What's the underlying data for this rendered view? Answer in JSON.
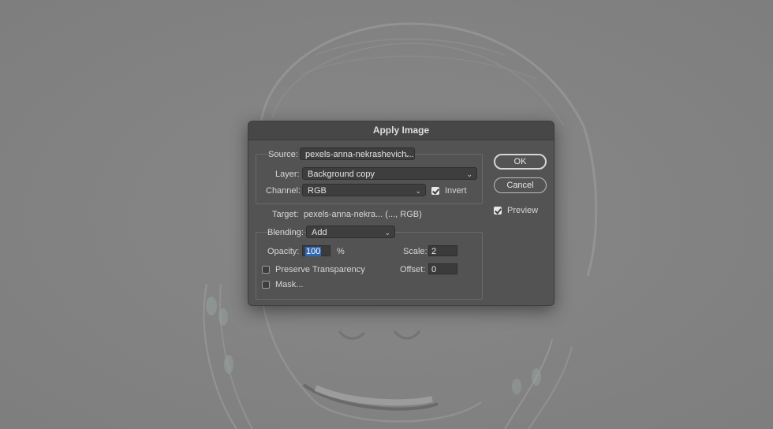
{
  "dialog": {
    "title": "Apply Image",
    "source": {
      "label": "Source:",
      "value": "pexels-anna-nekrashevich..."
    },
    "layer": {
      "label": "Layer:",
      "value": "Background copy"
    },
    "channel": {
      "label": "Channel:",
      "value": "RGB"
    },
    "invert": {
      "label": "Invert",
      "checked": true
    },
    "target": {
      "label": "Target:",
      "value": "pexels-anna-nekra... (..., RGB)"
    },
    "blending": {
      "label": "Blending:",
      "value": "Add"
    },
    "opacity": {
      "label": "Opacity:",
      "value": "100",
      "unit": "%"
    },
    "scale": {
      "label": "Scale:",
      "value": "2"
    },
    "offset": {
      "label": "Offset:",
      "value": "0"
    },
    "preserve_transparency": {
      "label": "Preserve Transparency",
      "checked": false
    },
    "mask": {
      "label": "Mask...",
      "checked": false
    },
    "ok_label": "OK",
    "cancel_label": "Cancel",
    "preview": {
      "label": "Preview",
      "checked": true
    }
  },
  "colors": {
    "canvas_gray": "#848484",
    "dialog_bg": "#535353",
    "titlebar_bg": "#474747",
    "selection_blue": "#2f67b5"
  },
  "icons": [
    "chevron-down-icon",
    "checkmark-icon"
  ]
}
